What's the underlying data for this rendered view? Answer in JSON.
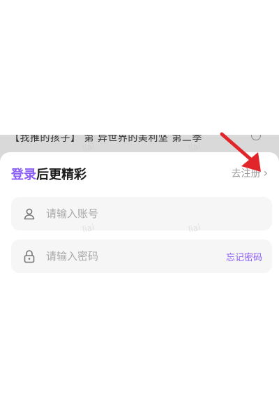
{
  "background": {
    "strip_text": "【我推的孩子】 第       异世界的美利坚 第二季"
  },
  "sheet": {
    "title_accent": "登录",
    "title_rest": "后更精彩",
    "register_label": "去注册",
    "register_chevron": "›"
  },
  "account_field": {
    "placeholder": "请输入账号",
    "icon": "user-icon"
  },
  "password_field": {
    "placeholder": "请输入密码",
    "icon": "lock-icon",
    "forgot_label": "忘记密码"
  },
  "watermark_text": "liai",
  "colors": {
    "accent": "#8b5cf6",
    "field_bg": "#f6f6f6",
    "arrow": "#e0262b"
  }
}
